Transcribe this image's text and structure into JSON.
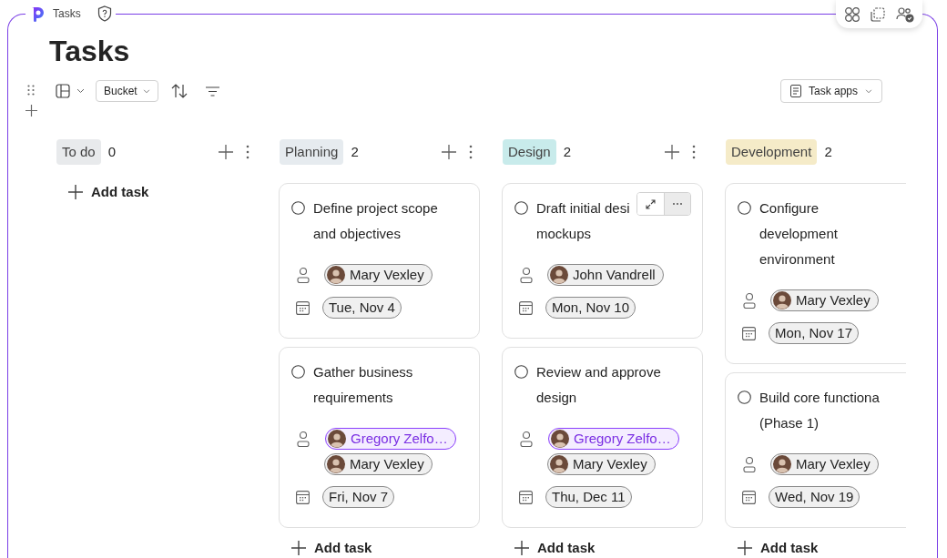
{
  "app": {
    "name": "Tasks"
  },
  "page_title": "Tasks",
  "toolbar": {
    "group_by": "Bucket",
    "task_apps": "Task apps"
  },
  "columns": [
    {
      "name": "To do",
      "count": "0",
      "color": "#e8eaec",
      "actions_visible": true,
      "add_task": "Add task"
    },
    {
      "name": "Planning",
      "count": "2",
      "color": "#e6ebef",
      "actions_visible": true,
      "add_task": "Add task",
      "tasks": [
        {
          "title_lines": [
            "Define project scope",
            "and objectives"
          ],
          "hovered": false,
          "assignees": [
            {
              "name": "Mary Vexley",
              "highlighted": false
            }
          ],
          "due": "Tue, Nov 4"
        },
        {
          "title_lines": [
            "Gather business",
            "requirements"
          ],
          "hovered": false,
          "assignees": [
            {
              "name": "Gregory Zelfo…",
              "highlighted": true
            },
            {
              "name": "Mary Vexley",
              "highlighted": false
            }
          ],
          "due": "Fri, Nov 7"
        }
      ]
    },
    {
      "name": "Design",
      "count": "2",
      "color": "#c8ebeb",
      "actions_visible": true,
      "add_task": "Add task",
      "tasks": [
        {
          "title_lines": [
            "Draft initial desi",
            "mockups"
          ],
          "hovered": true,
          "assignees": [
            {
              "name": "John Vandrell",
              "highlighted": false
            }
          ],
          "due": "Mon, Nov 10"
        },
        {
          "title_lines": [
            "Review and approve",
            "design"
          ],
          "hovered": false,
          "assignees": [
            {
              "name": "Gregory Zelfo…",
              "highlighted": true
            },
            {
              "name": "Mary Vexley",
              "highlighted": false
            }
          ],
          "due": "Thu, Dec 11"
        }
      ]
    },
    {
      "name": "Development",
      "count": "2",
      "color": "#f5ebc8",
      "actions_visible": false,
      "add_task": "Add task",
      "tasks": [
        {
          "title_lines": [
            "Configure",
            "development",
            "environment"
          ],
          "hovered": false,
          "assignees": [
            {
              "name": "Mary Vexley",
              "highlighted": false
            }
          ],
          "due": "Mon, Nov 17"
        },
        {
          "title_lines": [
            "Build core functiona",
            "(Phase 1)"
          ],
          "hovered": false,
          "assignees": [
            {
              "name": "Mary Vexley",
              "highlighted": false
            }
          ],
          "due": "Wed, Nov 19"
        }
      ]
    }
  ]
}
